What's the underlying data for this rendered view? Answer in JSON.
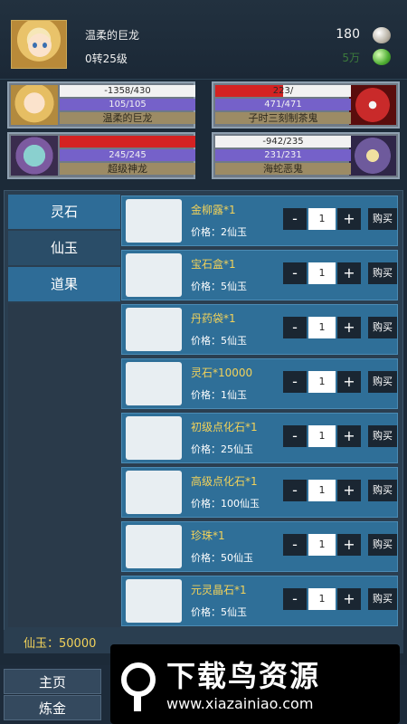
{
  "header": {
    "player_name": "温柔的巨龙",
    "level": "0转25级",
    "resource_1": "180",
    "resource_1_icon": "spirit-stone-icon",
    "resource_2": "5万",
    "resource_2_icon": "green-gem-icon"
  },
  "team": [
    {
      "name": "温柔的巨龙",
      "hp": "-1358/430",
      "hp_fill": 0,
      "mp": "105/105",
      "portrait": "blonde-girl-portrait"
    },
    {
      "name": "子时三刻制茶鬼",
      "hp": "223/",
      "hp_fill": 0.5,
      "mp": "471/471",
      "portrait": "red-ghost-portrait"
    },
    {
      "name": "超级神龙",
      "hp": "",
      "hp_fill": 1.0,
      "mp": "245/245",
      "portrait": "dragon-portrait"
    },
    {
      "name": "海蛇恶鬼",
      "hp": "-942/235",
      "hp_fill": 0,
      "mp": "231/231",
      "portrait": "sea-serpent-portrait"
    }
  ],
  "categories": [
    {
      "label": "灵石",
      "active": true
    },
    {
      "label": "仙玉",
      "active": false
    },
    {
      "label": "道果",
      "active": true
    }
  ],
  "items": [
    {
      "name": "金柳露*1",
      "price": "价格：2仙玉",
      "qty": "1",
      "icon": "willow-dew-bottle-icon"
    },
    {
      "name": "宝石盒*1",
      "price": "价格：5仙玉",
      "qty": "1",
      "icon": "treasure-chest-icon"
    },
    {
      "name": "丹药袋*1",
      "price": "价格：5仙玉",
      "qty": "1",
      "icon": "pill-pouch-icon"
    },
    {
      "name": "灵石*10000",
      "price": "价格：1仙玉",
      "qty": "1",
      "icon": "spirit-stone-icon"
    },
    {
      "name": "初级点化石*1",
      "price": "价格：25仙玉",
      "qty": "1",
      "icon": "orange-stone-icon"
    },
    {
      "name": "高级点化石*1",
      "price": "价格：100仙玉",
      "qty": "1",
      "icon": "blue-stone-icon"
    },
    {
      "name": "珍珠*1",
      "price": "价格：50仙玉",
      "qty": "1",
      "icon": "pearl-icon"
    },
    {
      "name": "元灵晶石*1",
      "price": "价格：5仙玉",
      "qty": "1",
      "icon": "purple-crystal-icon"
    }
  ],
  "controls": {
    "minus": "-",
    "plus": "+",
    "buy": "购买"
  },
  "balance": "仙玉：50000",
  "nav": {
    "home": "主页",
    "alchemy": "炼金"
  },
  "watermark": {
    "title": "下载鸟资源",
    "url": "www.xiazainiao.com"
  }
}
